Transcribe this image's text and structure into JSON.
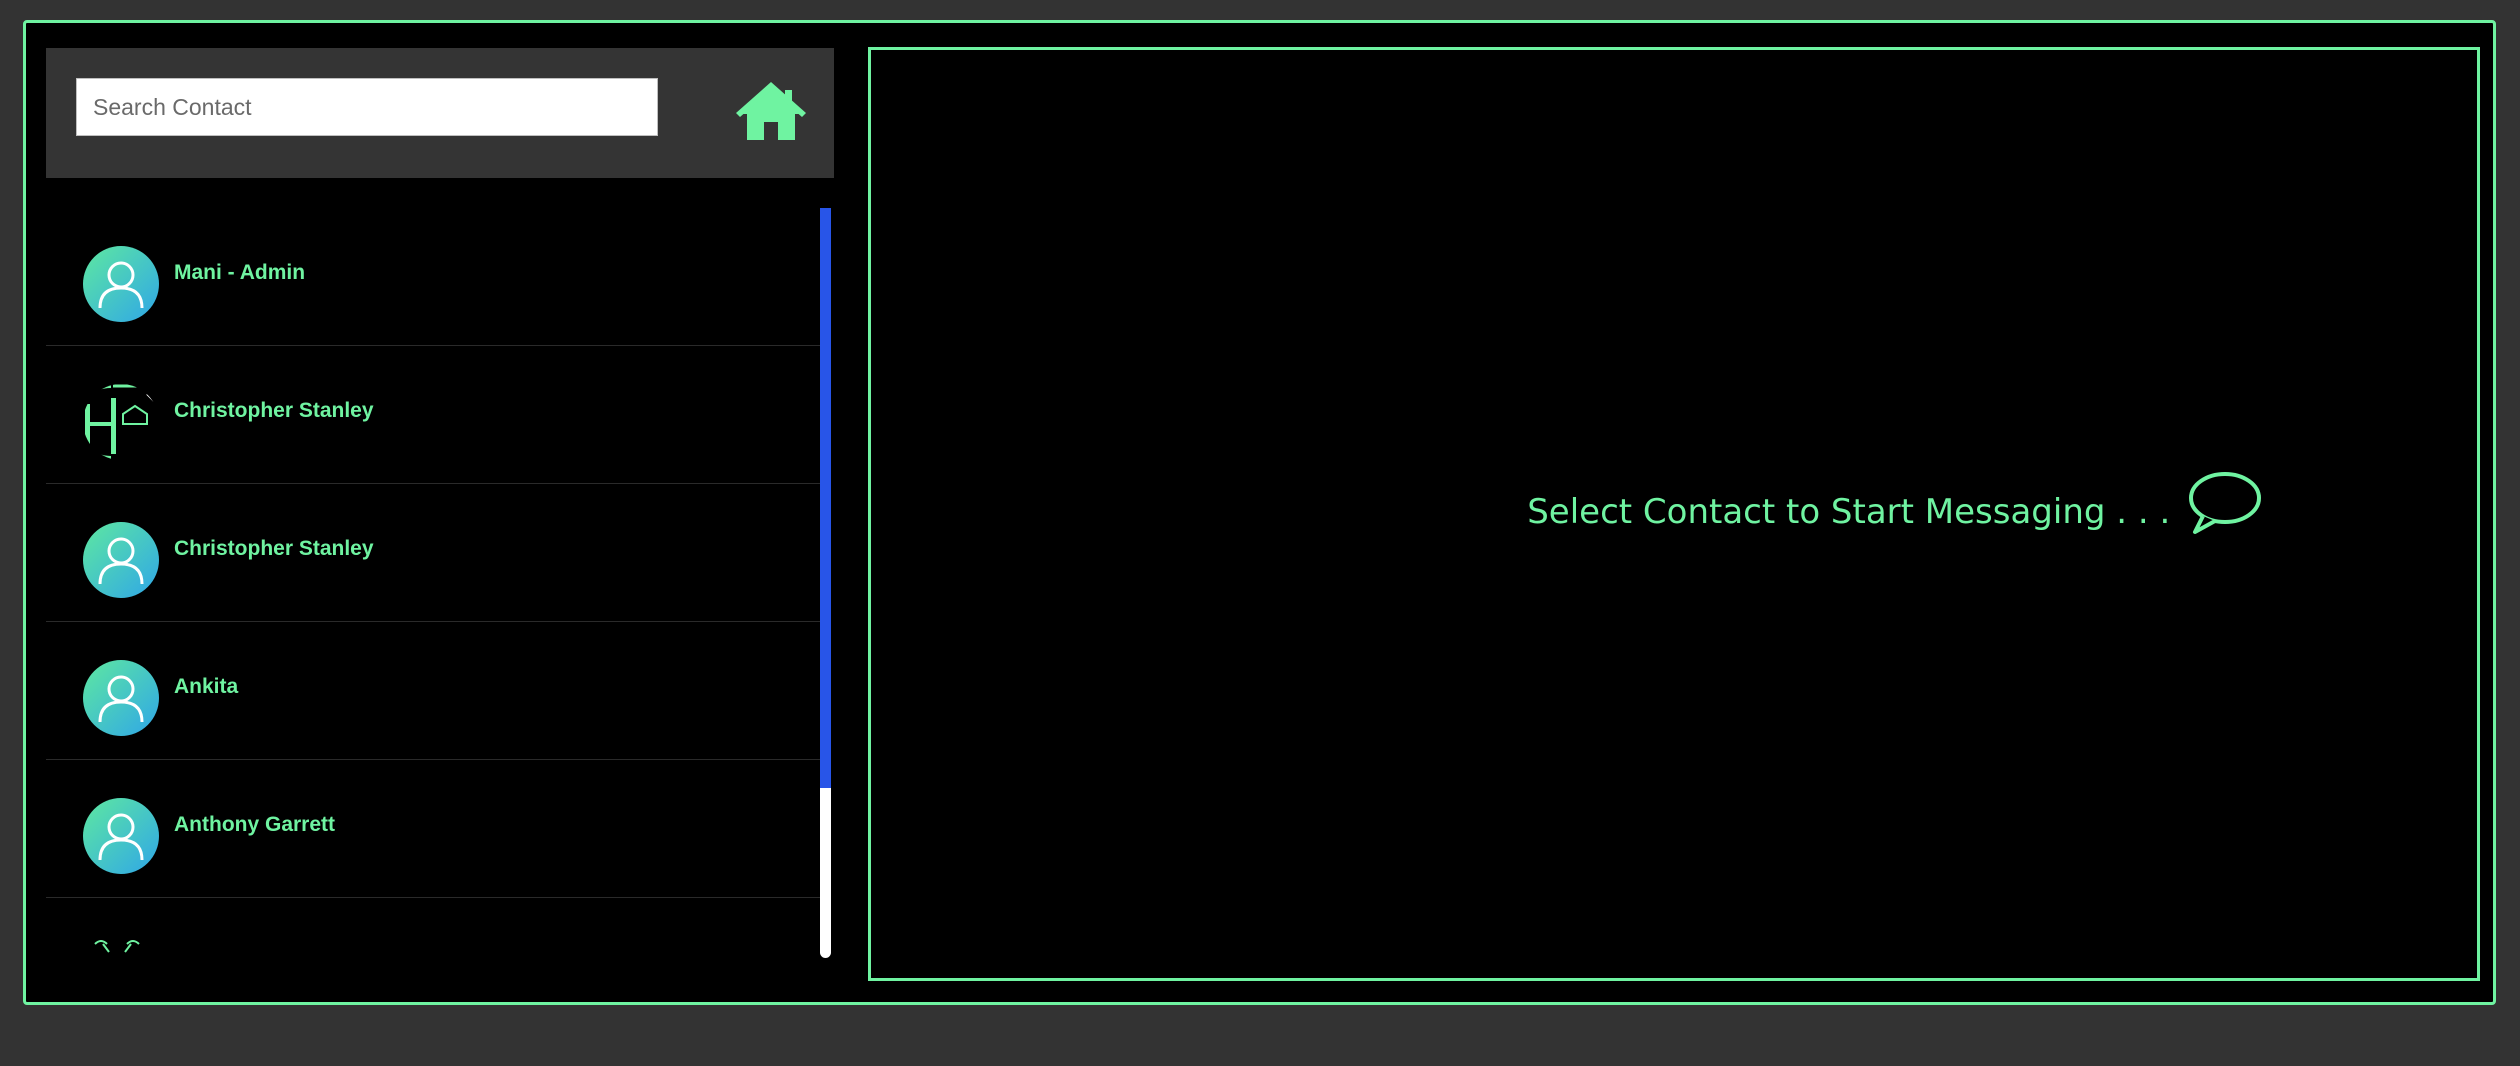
{
  "search": {
    "placeholder": "Search Contact",
    "value": ""
  },
  "header": {
    "home_icon": "home-icon"
  },
  "contacts": [
    {
      "name": "Mani - Admin",
      "avatar": "user-avatar"
    },
    {
      "name": "Christopher Stanley",
      "avatar": "logo-avatar"
    },
    {
      "name": "Christopher Stanley",
      "avatar": "user-avatar"
    },
    {
      "name": "Ankita",
      "avatar": "user-avatar"
    },
    {
      "name": "Anthony Garrett",
      "avatar": "user-avatar"
    }
  ],
  "chat": {
    "placeholder_text": "Select Contact to Start Messaging . . .",
    "icon": "speech-bubble-icon"
  },
  "colors": {
    "accent": "#6ff3a1",
    "background": "#333333",
    "panel": "#000000",
    "scroll_thumb": "#2855e8"
  }
}
